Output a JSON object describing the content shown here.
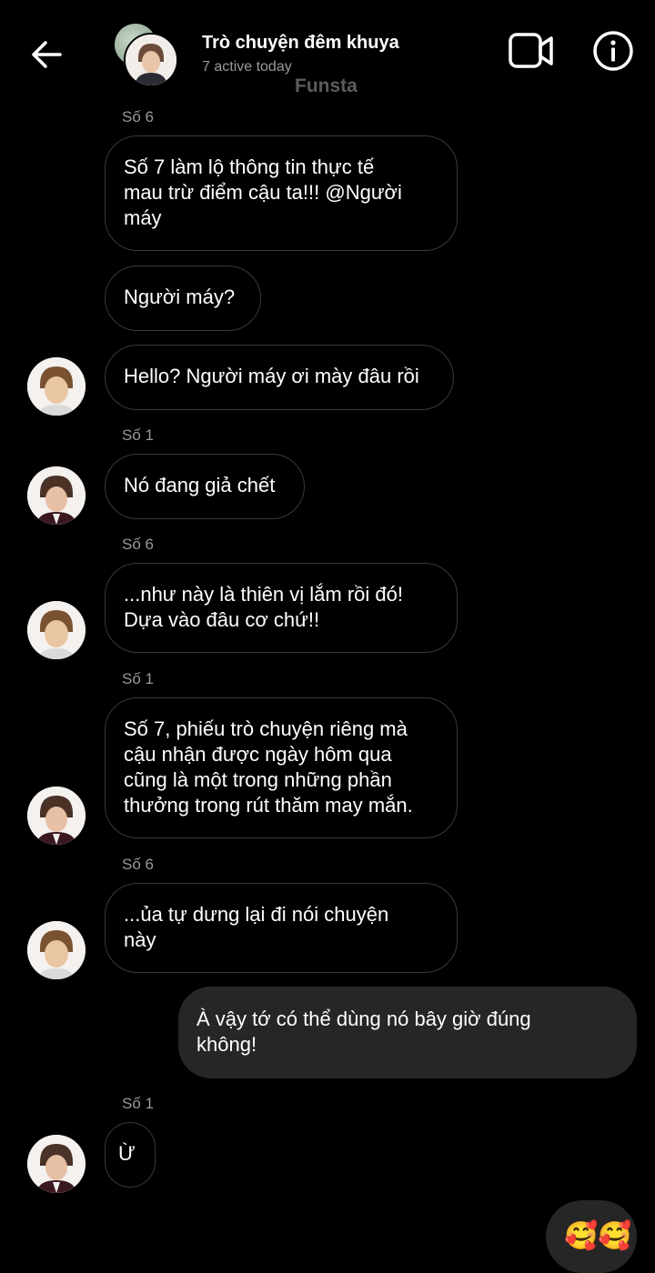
{
  "header": {
    "title": "Trò chuyện đêm khuya",
    "subtitle": "7 active today",
    "watermark": "Funsta"
  },
  "icons": {
    "back": "arrow-left-icon",
    "video": "video-camera-icon",
    "info": "info-icon"
  },
  "messages": [
    {
      "sender": "Số 6",
      "text": "Số 7 làm lộ thông tin thực tế\nmau trừ điểm cậu ta!!! @Người\nmáy"
    },
    {
      "text": "Người máy?"
    },
    {
      "text": "Hello? Người máy ơi mày đâu rồi"
    },
    {
      "sender": "Số 1",
      "text": "Nó đang giả chết"
    },
    {
      "sender": "Số 6",
      "text": "...như này là thiên vị lắm rồi đó!\nDựa vào đâu cơ chứ!!"
    },
    {
      "sender": "Số 1",
      "text": "Số 7, phiếu trò chuyện riêng mà\ncậu nhận được ngày hôm qua\ncũng là một trong những phần\nthưởng trong rút thăm may mắn."
    },
    {
      "sender": "Số 6",
      "text": "...ủa tự dưng lại đi nói chuyện\nnày"
    },
    {
      "outgoing": true,
      "text": "À vậy tớ có thể dùng nó bây giờ đúng\nkhông!"
    },
    {
      "sender": "Số 1",
      "text": "Ừ"
    },
    {
      "outgoing": true,
      "text": "🥰🥰"
    }
  ],
  "colors": {
    "background": "#000000",
    "outgoing_bubble": "#262626",
    "incoming_border": "#3a3a3a",
    "meta_text": "#9a9a9a"
  }
}
